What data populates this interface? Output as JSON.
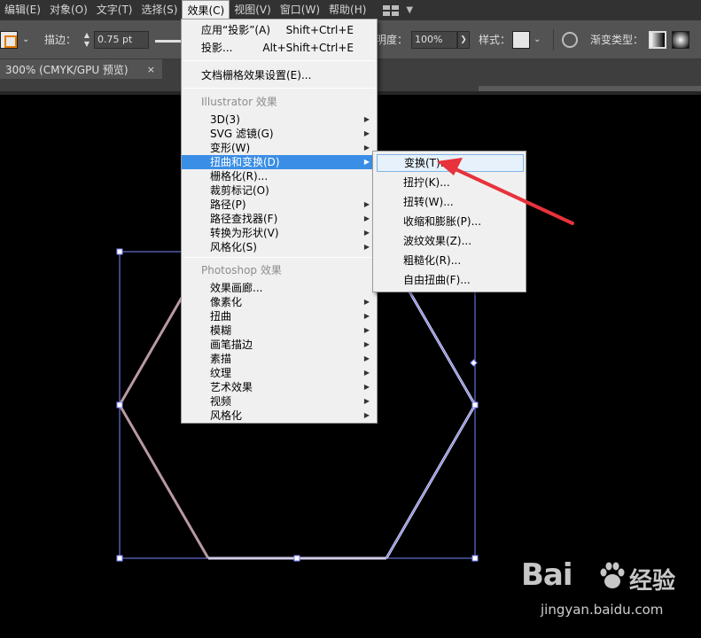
{
  "menubar": {
    "items": [
      {
        "label": "编辑(E)"
      },
      {
        "label": "对象(O)"
      },
      {
        "label": "文字(T)"
      },
      {
        "label": "选择(S)"
      },
      {
        "label": "效果(C)"
      },
      {
        "label": "视图(V)"
      },
      {
        "label": "窗口(W)"
      },
      {
        "label": "帮助(H)"
      }
    ]
  },
  "controlbar": {
    "stroke_label": "描边：",
    "stroke_value": "0.75 pt",
    "opacity_label": "明度：",
    "opacity_value": "100%",
    "style_label": "样式：",
    "gradient_label": "渐变类型："
  },
  "document_tab": {
    "title": "300% (CMYK/GPU 预览)",
    "close_glyph": "×"
  },
  "effect_menu": {
    "apply_last": {
      "label": "应用“投影”(A)",
      "shortcut": "Shift+Ctrl+E"
    },
    "last_effect": {
      "label": "投影...",
      "shortcut": "Alt+Shift+Ctrl+E"
    },
    "raster_settings": "文档栅格效果设置(E)...",
    "illustrator_header": "Illustrator 效果",
    "illustrator_items": [
      {
        "label": "3D(3)",
        "submenu": true
      },
      {
        "label": "SVG 滤镜(G)",
        "submenu": true
      },
      {
        "label": "变形(W)",
        "submenu": true
      },
      {
        "label": "扭曲和变换(D)",
        "submenu": true
      },
      {
        "label": "栅格化(R)...",
        "submenu": false
      },
      {
        "label": "裁剪标记(O)",
        "submenu": false
      },
      {
        "label": "路径(P)",
        "submenu": true
      },
      {
        "label": "路径查找器(F)",
        "submenu": true
      },
      {
        "label": "转换为形状(V)",
        "submenu": true
      },
      {
        "label": "风格化(S)",
        "submenu": true
      }
    ],
    "photoshop_header": "Photoshop 效果",
    "photoshop_items": [
      {
        "label": "效果画廊...",
        "submenu": false
      },
      {
        "label": "像素化",
        "submenu": true
      },
      {
        "label": "扭曲",
        "submenu": true
      },
      {
        "label": "模糊",
        "submenu": true
      },
      {
        "label": "画笔描边",
        "submenu": true
      },
      {
        "label": "素描",
        "submenu": true
      },
      {
        "label": "纹理",
        "submenu": true
      },
      {
        "label": "艺术效果",
        "submenu": true
      },
      {
        "label": "视频",
        "submenu": true
      },
      {
        "label": "风格化",
        "submenu": true
      }
    ],
    "highlighted_item": "扭曲和变换(D)"
  },
  "distort_submenu": {
    "items": [
      {
        "label": "变换(T)..."
      },
      {
        "label": "扭拧(K)..."
      },
      {
        "label": "扭转(W)..."
      },
      {
        "label": "收缩和膨胀(P)..."
      },
      {
        "label": "波纹效果(Z)..."
      },
      {
        "label": "粗糙化(R)..."
      },
      {
        "label": "自由扭曲(F)..."
      }
    ],
    "highlighted_item": "变换(T)..."
  },
  "watermark": {
    "logo_text": "Bai",
    "logo_suffix": "经验",
    "url": "jingyan.baidu.com"
  },
  "colors": {
    "menu_highlight": "#3a8ee6",
    "selection_box": "#7c86ff",
    "annotation_arrow": "#e8323c",
    "hexagon_left": "#b89aa0",
    "hexagon_right": "#d8d4f0"
  }
}
